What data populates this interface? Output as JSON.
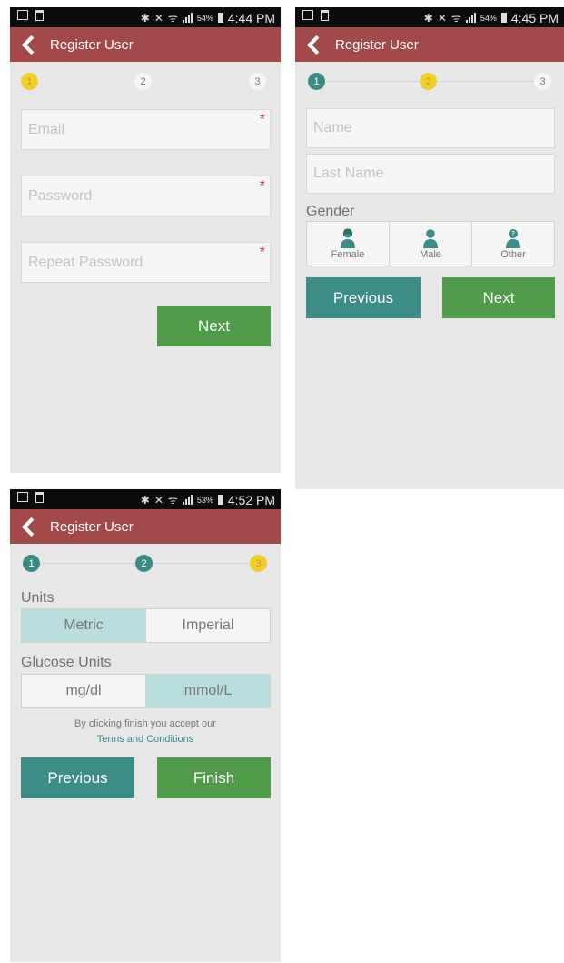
{
  "screens": [
    {
      "status": {
        "battery": "54%",
        "time": "4:44 PM"
      },
      "title": "Register User",
      "steps": [
        "1",
        "2",
        "3"
      ],
      "fields": [
        {
          "placeholder": "Email",
          "required": "*"
        },
        {
          "placeholder": "Password",
          "required": "*"
        },
        {
          "placeholder": "Repeat Password",
          "required": "*"
        }
      ],
      "next_label": "Next"
    },
    {
      "status": {
        "battery": "54%",
        "time": "4:45 PM"
      },
      "title": "Register User",
      "steps": [
        "1",
        "2",
        "3"
      ],
      "fields": [
        {
          "placeholder": "Name"
        },
        {
          "placeholder": "Last Name"
        }
      ],
      "gender_label": "Gender",
      "gender_options": [
        {
          "label": "Female",
          "icon": "female-user-icon"
        },
        {
          "label": "Male",
          "icon": "male-user-icon"
        },
        {
          "label": "Other",
          "icon": "other-user-icon"
        }
      ],
      "previous_label": "Previous",
      "next_label": "Next"
    },
    {
      "status": {
        "battery": "53%",
        "time": "4:52 PM"
      },
      "title": "Register User",
      "steps": [
        "1",
        "2",
        "3"
      ],
      "units_label": "Units",
      "units_options": [
        "Metric",
        "Imperial"
      ],
      "units_selected": "Metric",
      "glucose_label": "Glucose Units",
      "glucose_options": [
        "mg/dl",
        "mmol/L"
      ],
      "glucose_selected": "mmol/L",
      "terms_text": "By clicking finish you accept our",
      "terms_link": "Terms and Conditions",
      "previous_label": "Previous",
      "finish_label": "Finish"
    }
  ],
  "colors": {
    "appbar": "#a24a4a",
    "step_active": "#f3cd2a",
    "step_done": "#3a8b86",
    "button_green": "#4f9b48",
    "button_teal": "#3c8c88",
    "segment_selected": "#b8dedd",
    "required": "#b83a3a"
  }
}
